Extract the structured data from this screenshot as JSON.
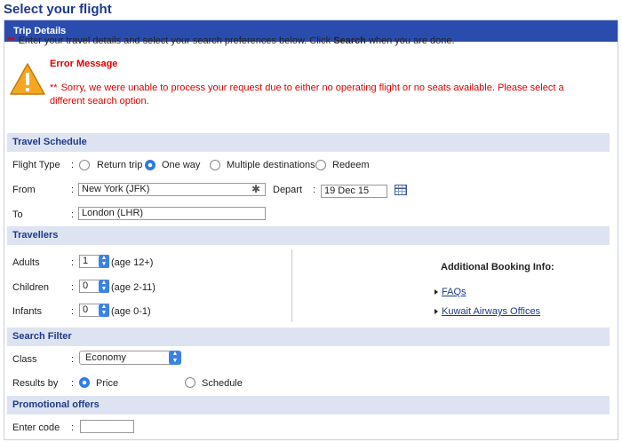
{
  "page": {
    "title": "Select your flight"
  },
  "trip": {
    "header": "Trip Details"
  },
  "intro": {
    "required_mark": "**",
    "text_before": "Enter your travel details and select your search preferences below. Click ",
    "text_bold": "Search",
    "text_after": " when you are done."
  },
  "error": {
    "icon": "warning-triangle-icon",
    "title": "Error Message",
    "message": "Sorry, we were unable to process your request due to either no operating flight or no seats available. Please select a different search option."
  },
  "travel_schedule": {
    "section_title": "Travel Schedule",
    "flight_type_label": "Flight Type",
    "flight_types": [
      "Return trip",
      "One way",
      "Multiple destinations",
      "Redeem"
    ],
    "selected_flight_type": "One way",
    "from_label": "From",
    "from_value": "New York (JFK)",
    "depart_label": "Depart",
    "depart_value": "19 Dec 15",
    "to_label": "To",
    "to_value": "London (LHR)",
    "colon": ":"
  },
  "travellers": {
    "section_title": "Travellers",
    "adults_label": "Adults",
    "adults_value": "1",
    "adults_age": "(age 12+)",
    "children_label": "Children",
    "children_value": "0",
    "children_age": "(age 2-11)",
    "infants_label": "Infants",
    "infants_value": "0",
    "infants_age": "(age 0-1)",
    "additional_title": "Additional Booking Info:",
    "links": [
      "FAQs",
      "Kuwait Airways Offices"
    ]
  },
  "search_filter": {
    "section_title": "Search Filter",
    "class_label": "Class",
    "class_value": "Economy",
    "results_label": "Results by",
    "results_options": [
      "Price",
      "Schedule"
    ],
    "selected_result": "Price"
  },
  "promo": {
    "section_title": "Promotional offers",
    "code_label": "Enter code",
    "code_value": ""
  },
  "colors": {
    "header_bg": "#2a4cae",
    "section_bg": "#dde3f1",
    "error": "#d00000",
    "accent": "#2a7de1"
  }
}
